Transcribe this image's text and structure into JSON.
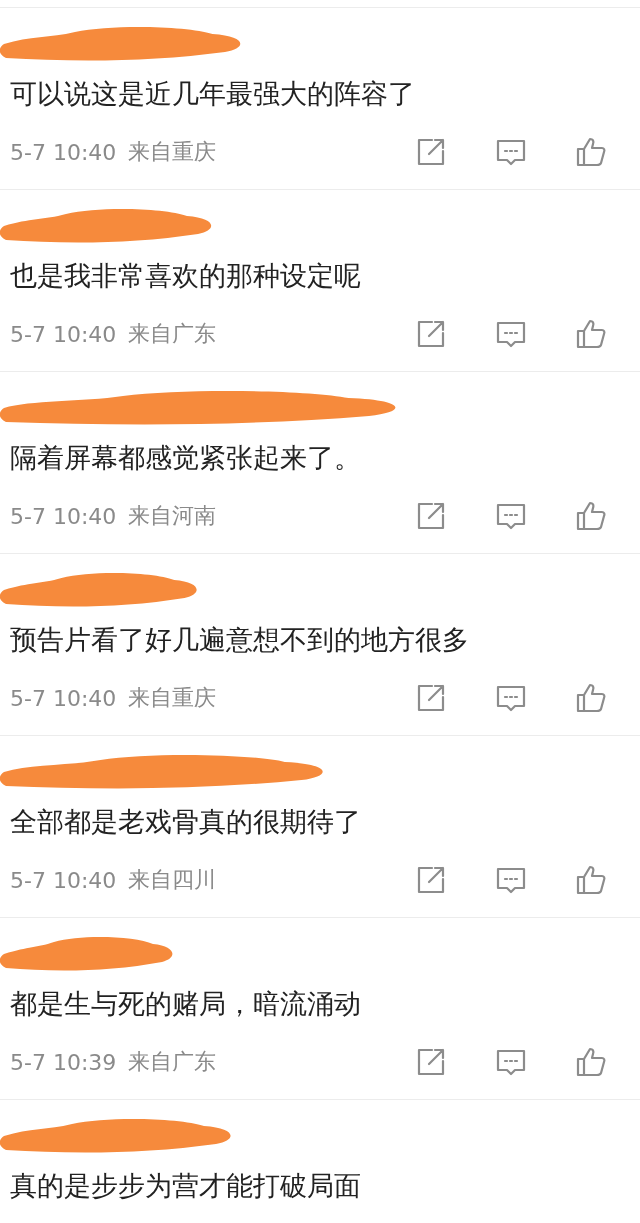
{
  "comments": [
    {
      "text": "可以说这是近几年最强大的阵容了",
      "time": "5-7 10:40",
      "location": "来自重庆"
    },
    {
      "text": "也是我非常喜欢的那种设定呢",
      "time": "5-7 10:40",
      "location": "来自广东"
    },
    {
      "text": "隔着屏幕都感觉紧张起来了。",
      "time": "5-7 10:40",
      "location": "来自河南"
    },
    {
      "text": "预告片看了好几遍意想不到的地方很多",
      "time": "5-7 10:40",
      "location": "来自重庆"
    },
    {
      "text": "全部都是老戏骨真的很期待了",
      "time": "5-7 10:40",
      "location": "来自四川"
    },
    {
      "text": "都是生与死的赌局，暗流涌动",
      "time": "5-7 10:39",
      "location": "来自广东"
    },
    {
      "text": "真的是步步为营才能打破局面"
    }
  ]
}
